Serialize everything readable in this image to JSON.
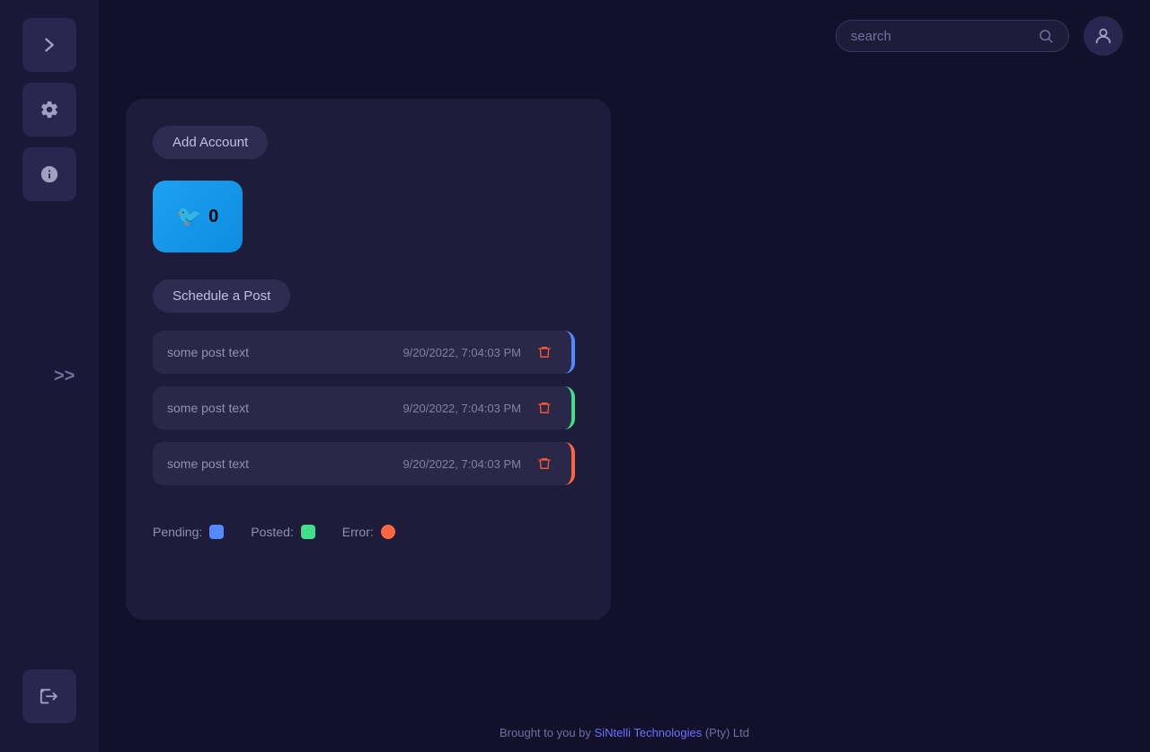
{
  "sidebar": {
    "buttons": [
      {
        "id": "expand",
        "icon": "▶",
        "label": "Expand sidebar"
      },
      {
        "id": "settings",
        "icon": "⚙",
        "label": "Settings"
      },
      {
        "id": "info",
        "icon": "ℹ",
        "label": "Info"
      },
      {
        "id": "logout",
        "icon": "↪",
        "label": "Logout"
      }
    ],
    "chevron_label": ">>"
  },
  "header": {
    "search_placeholder": "search"
  },
  "card": {
    "add_account_label": "Add Account",
    "twitter_count": "0",
    "schedule_label": "Schedule a Post",
    "posts": [
      {
        "text": "some post text",
        "date": "9/20/2022, 7:04:03 PM",
        "status": "pending"
      },
      {
        "text": "some post text",
        "date": "9/20/2022, 7:04:03 PM",
        "status": "posted"
      },
      {
        "text": "some post text",
        "date": "9/20/2022, 7:04:03 PM",
        "status": "error"
      }
    ],
    "legend": {
      "pending_label": "Pending:",
      "posted_label": "Posted:",
      "error_label": "Error:"
    }
  },
  "footer": {
    "prefix": "Brought to you by ",
    "company": "SiNtelli Technologies",
    "suffix": " (Pty) Ltd"
  }
}
